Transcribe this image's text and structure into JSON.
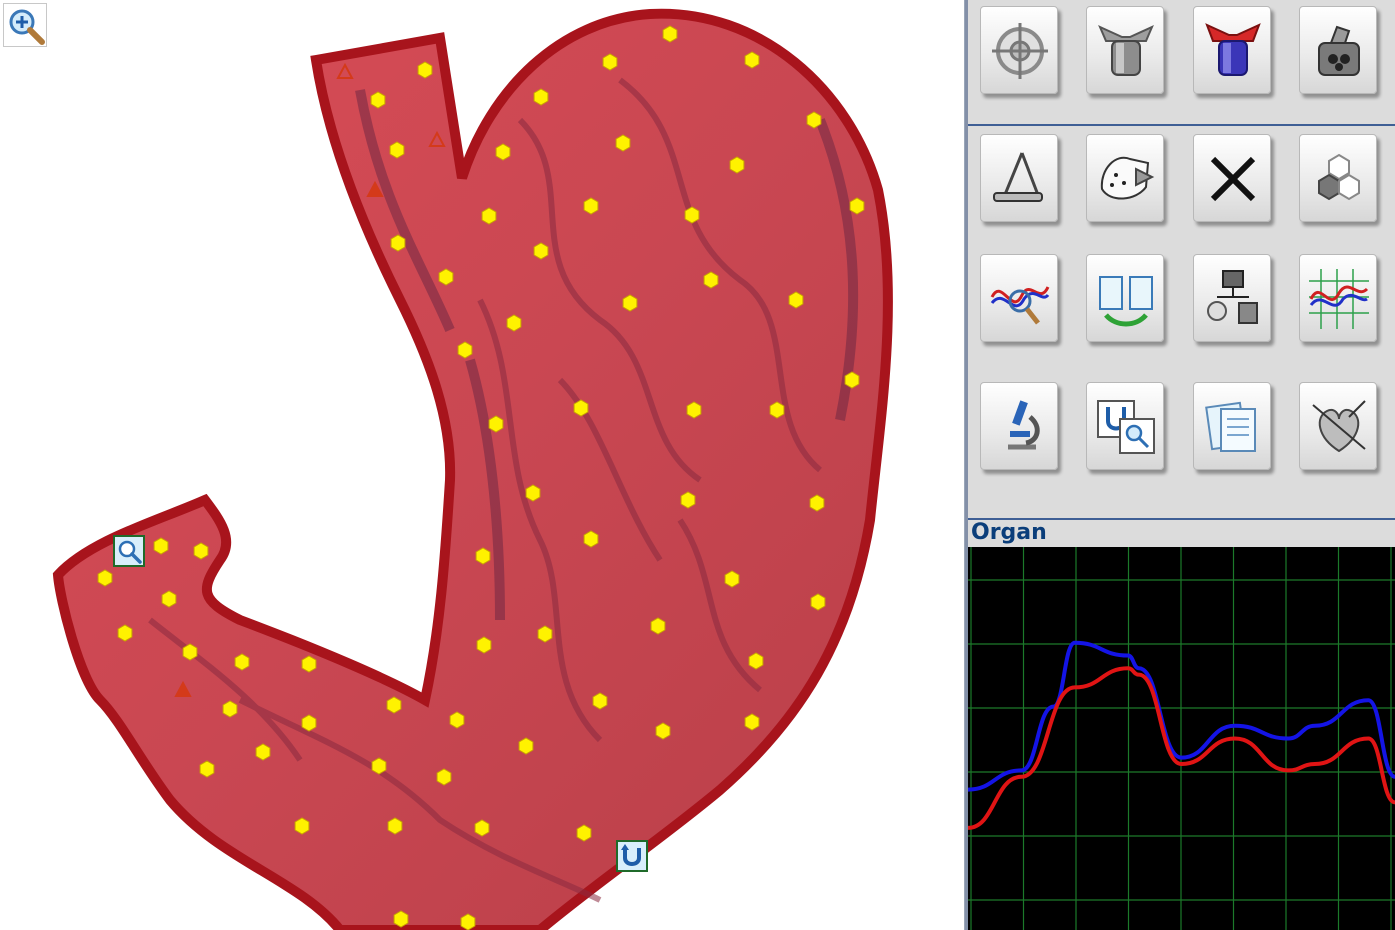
{
  "panel": {
    "organ_label": "Organ"
  },
  "icons": {
    "zoom": "zoom-in-icon",
    "marker_search": "magnifier-icon",
    "marker_curve": "u-curve-icon"
  },
  "toolbar": {
    "rows": [
      [
        "target-icon",
        "gray-funnel-icon",
        "red-blue-funnel-icon",
        "machine-icon"
      ],
      [
        "compass-icon",
        "map-pointer-icon",
        "close-x-icon",
        "hexagons-icon"
      ],
      [
        "wave-magnifier-icon",
        "compare-documents-icon",
        "organ-diagram-icon",
        "graph-lines-icon"
      ],
      [
        "microscope-icon",
        "search-window-icon",
        "notes-icon",
        "heart-icon"
      ]
    ]
  },
  "colors": {
    "marker_fill": "#fff200",
    "marker_stroke": "#c9a400",
    "triangle_fill": "#d43a1a",
    "grid": "#1c7a2a",
    "series_blue": "#1414e6",
    "series_red": "#e01414",
    "panel_title": "#0b3e7a"
  },
  "chart_data": {
    "type": "line",
    "grid": true,
    "xlim": [
      0,
      8
    ],
    "ylim": [
      0,
      6
    ],
    "series": [
      {
        "color": "#1414e6",
        "x": [
          0,
          1,
          1.6,
          2,
          3,
          3.2,
          4,
          5,
          6,
          6.5,
          7.5,
          8
        ],
        "y": [
          2.2,
          2.5,
          3.5,
          4.5,
          4.3,
          4.1,
          2.7,
          3.2,
          3.0,
          3.2,
          3.6,
          2.4
        ]
      },
      {
        "color": "#e01414",
        "x": [
          0,
          1,
          2,
          3,
          3.2,
          4,
          5,
          6,
          6.5,
          7.5,
          8
        ],
        "y": [
          1.6,
          2.4,
          3.8,
          4.1,
          4.0,
          2.6,
          3.0,
          2.5,
          2.6,
          3.0,
          2.0
        ]
      }
    ]
  }
}
